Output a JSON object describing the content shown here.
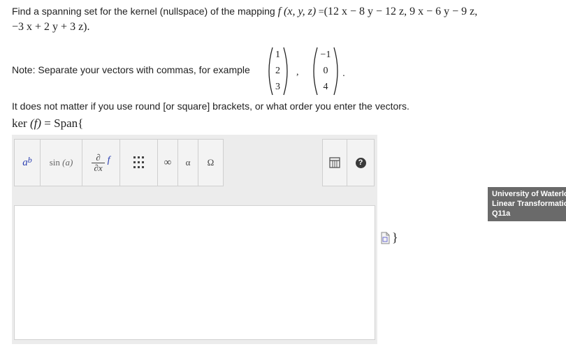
{
  "question": {
    "text_before": "Find a spanning set for the kernel (nullspace) of the mapping ",
    "function_sig": "f (x, y, z)",
    "equals": " =",
    "mapping_line1": "(12 x − 8 y − 12 z, 9 x − 6 y − 9 z,",
    "mapping_line2": "−3 x + 2 y + 3 z)."
  },
  "note": {
    "text": "Note: Separate your vectors with commas, for example",
    "vector1": [
      "1",
      "2",
      "3"
    ],
    "vector2": [
      "−1",
      "0",
      "4"
    ],
    "separator": ",",
    "period": "."
  },
  "instructions": "It does not matter if you use round [or square] brackets, or what order you enter the vectors.",
  "kernel_prefix": {
    "ker": "ker",
    "arg": "(f)",
    "equals": "=",
    "span": "Span{"
  },
  "toolbar": {
    "superscript_base": "a",
    "superscript_exp": "b",
    "sin_label": "sin",
    "sin_arg": "(a)",
    "partial_num": "∂",
    "partial_den": "∂x",
    "partial_f": "f",
    "infinity": "∞",
    "alpha": "α",
    "omega": "Ω",
    "help": "?"
  },
  "answer_value": "",
  "closing_brace": "}",
  "tooltip": {
    "line1": "University of Waterloo",
    "line2": "Linear Transformations",
    "line3": "Q11a"
  },
  "colors": {
    "editor_bg": "#ececec",
    "button_bg": "#f3f3f3",
    "superscript_accent": "#2a3eb1",
    "tooltip_bg": "#6a6a6a"
  },
  "icons": [
    "matrix-icon",
    "keyboard-icon",
    "help-icon",
    "formula-doc-icon"
  ]
}
